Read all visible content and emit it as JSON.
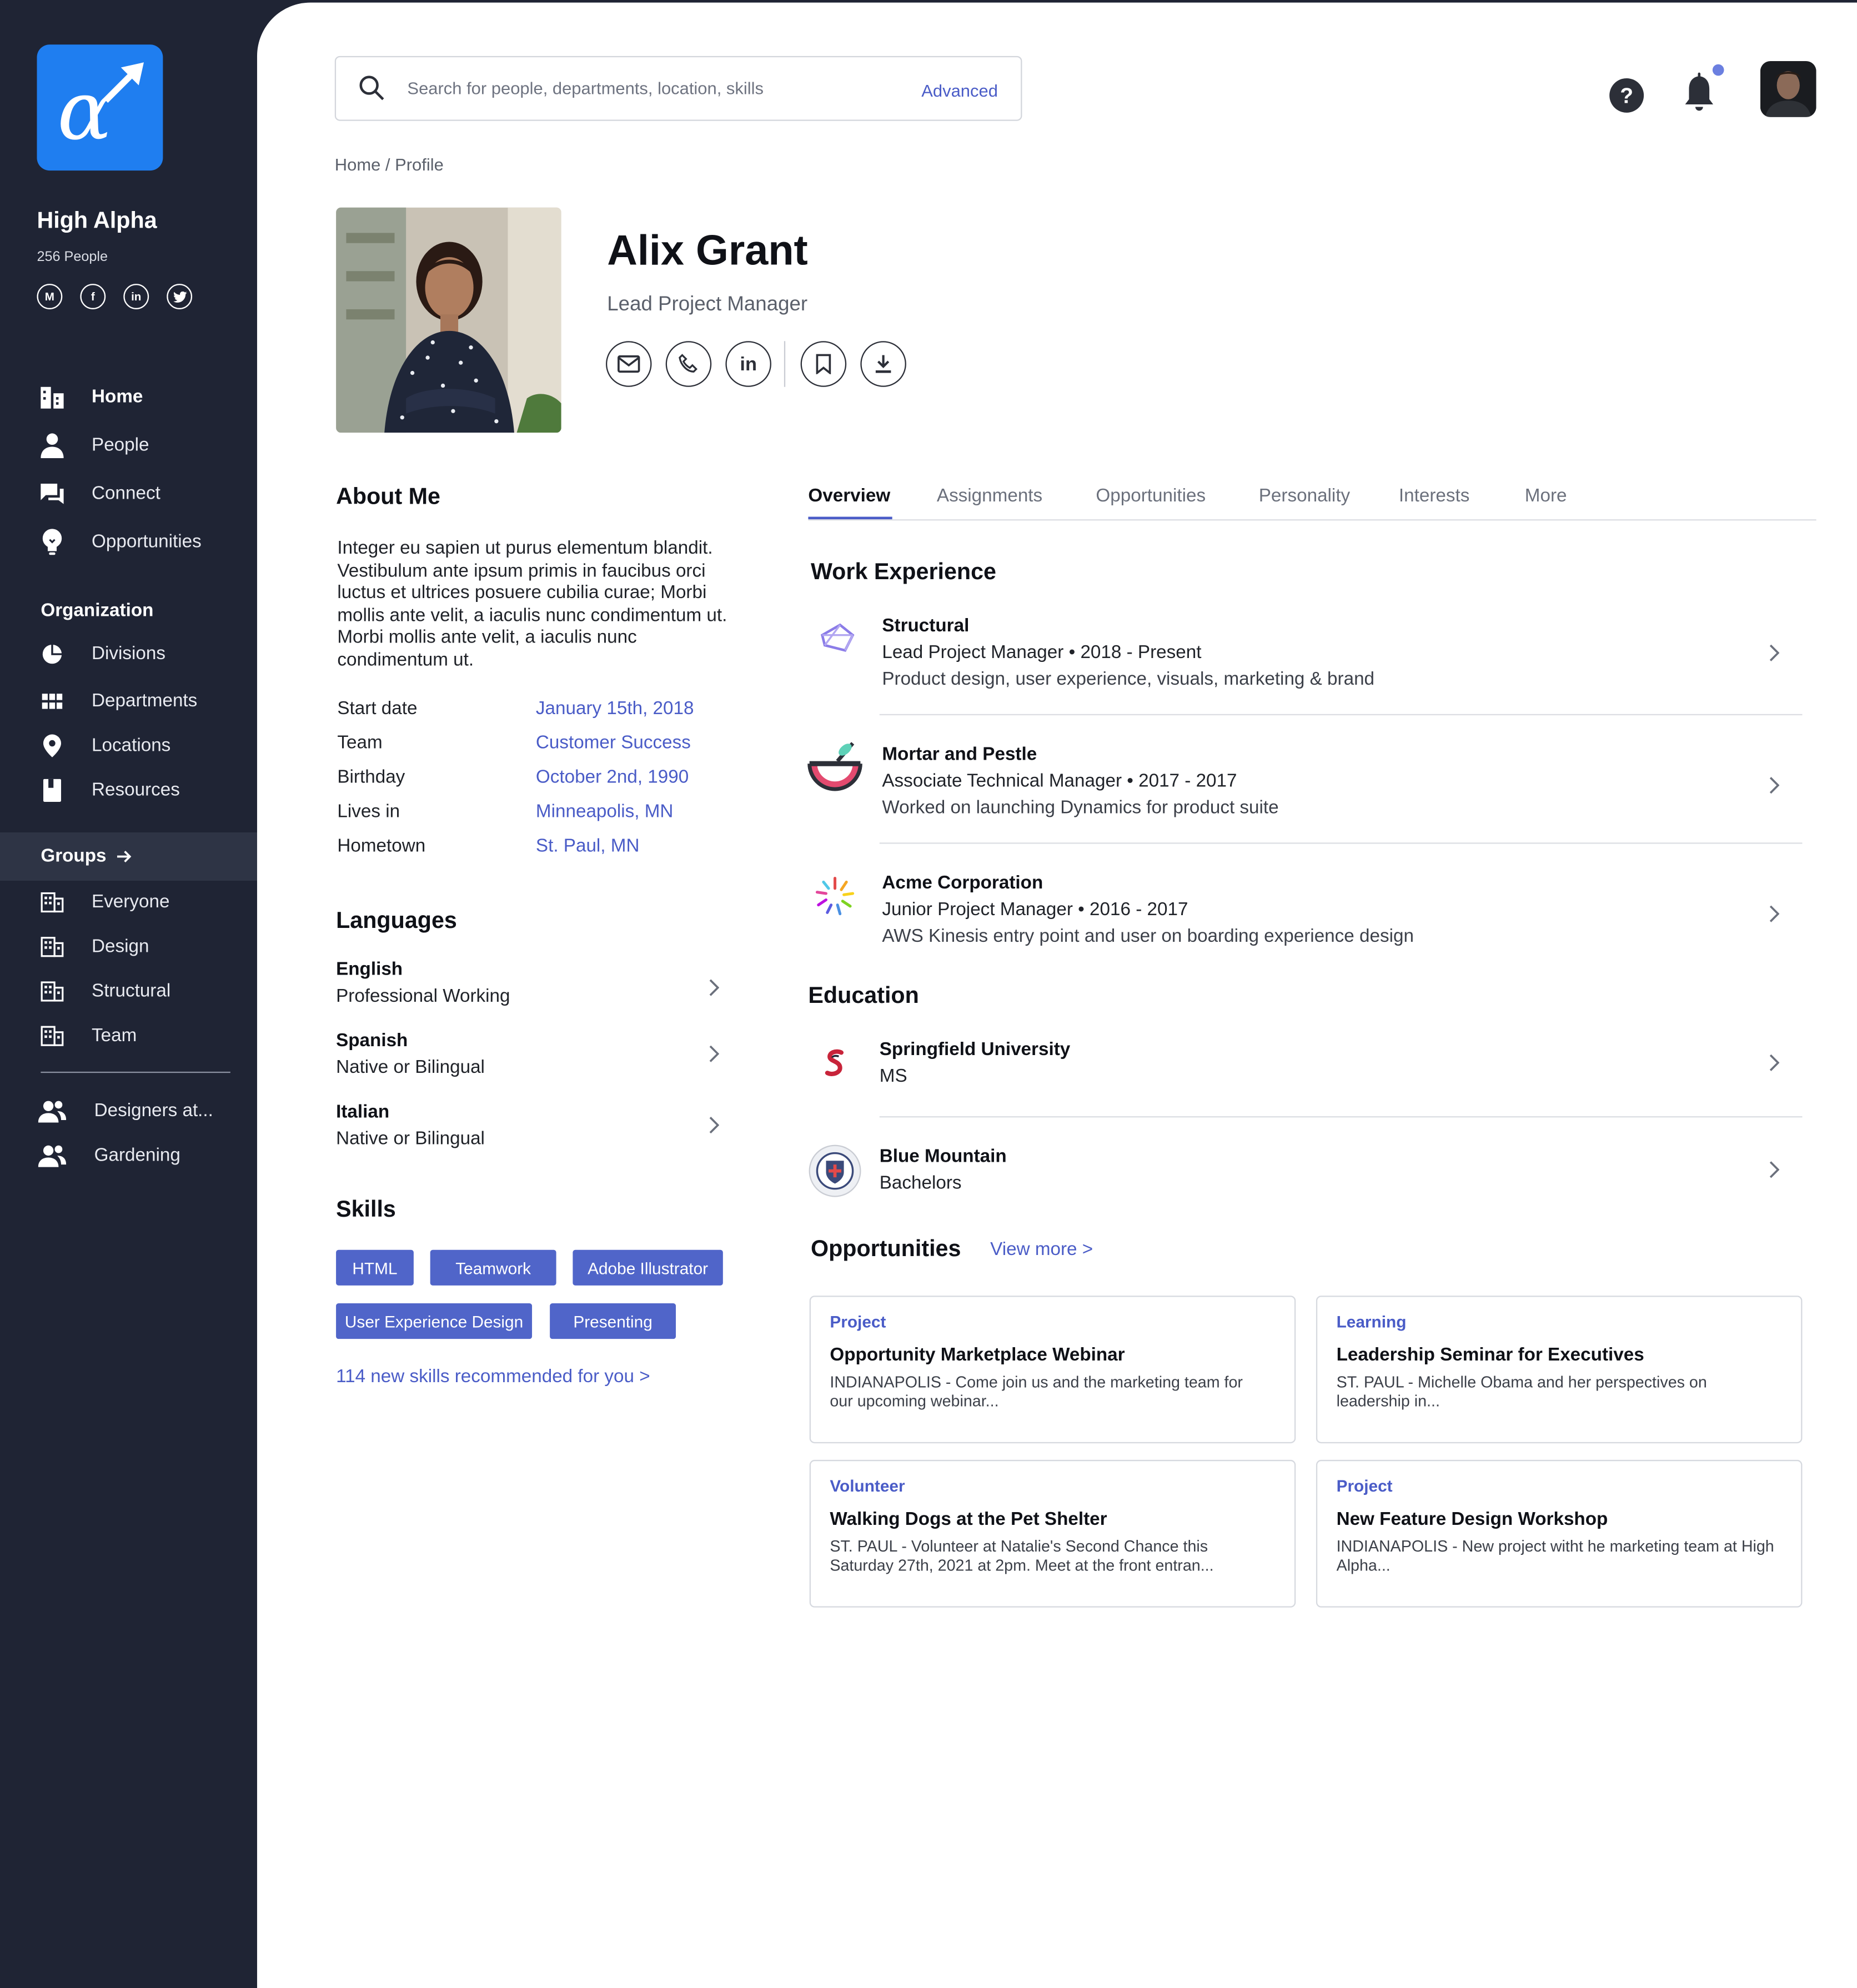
{
  "org": {
    "name": "High Alpha",
    "count": "256 People",
    "socials": [
      {
        "label": "M",
        "icon": "medium-icon"
      },
      {
        "label": "f",
        "icon": "facebook-icon"
      },
      {
        "label": "in",
        "icon": "linkedin-icon"
      },
      {
        "label": "t",
        "icon": "twitter-icon"
      }
    ]
  },
  "nav": {
    "main": [
      {
        "label": "Home",
        "icon": "building-icon"
      },
      {
        "label": "People",
        "icon": "person-icon"
      },
      {
        "label": "Connect",
        "icon": "chat-icon"
      },
      {
        "label": "Opportunities",
        "icon": "lightbulb-icon"
      }
    ],
    "organization_title": "Organization",
    "organization": [
      {
        "label": "Divisions",
        "icon": "pie-icon"
      },
      {
        "label": "Departments",
        "icon": "grid-icon"
      },
      {
        "label": "Locations",
        "icon": "pin-icon"
      },
      {
        "label": "Resources",
        "icon": "book-icon"
      }
    ],
    "groups_title": "Groups",
    "groups": [
      {
        "label": "Everyone",
        "icon": "office-icon"
      },
      {
        "label": "Design",
        "icon": "office-icon"
      },
      {
        "label": "Structural",
        "icon": "office-icon"
      },
      {
        "label": "Team",
        "icon": "office-icon"
      }
    ],
    "custom_groups": [
      {
        "label": "Designers at...",
        "icon": "people-icon"
      },
      {
        "label": "Gardening",
        "icon": "people-icon"
      }
    ]
  },
  "search": {
    "placeholder": "Search for people, departments, location, skills",
    "advanced": "Advanced"
  },
  "breadcrumb": "Home / Profile",
  "profile": {
    "name": "Alix Grant",
    "title": "Lead Project Manager",
    "actions": [
      "email-icon",
      "phone-icon",
      "linkedin-icon",
      "bookmark-icon",
      "download-icon"
    ]
  },
  "about": {
    "title": "About Me",
    "text": "Integer eu sapien ut purus elementum blandit. Vestibulum ante ipsum primis in faucibus orci luctus et ultrices posuere cubilia curae; Morbi mollis ante velit, a iaculis nunc condimentum ut. Morbi mollis ante velit, a iaculis nunc condimentum ut.",
    "facts": [
      {
        "label": "Start date",
        "value": "January 15th, 2018"
      },
      {
        "label": "Team",
        "value": "Customer Success"
      },
      {
        "label": "Birthday",
        "value": "October 2nd, 1990"
      },
      {
        "label": "Lives in",
        "value": "Minneapolis, MN"
      },
      {
        "label": "Hometown",
        "value": "St. Paul, MN"
      }
    ]
  },
  "languages": {
    "title": "Languages",
    "items": [
      {
        "name": "English",
        "level": "Professional Working"
      },
      {
        "name": "Spanish",
        "level": "Native or Bilingual"
      },
      {
        "name": "Italian",
        "level": "Native or Bilingual"
      }
    ]
  },
  "skills": {
    "title": "Skills",
    "items": [
      "HTML",
      "Teamwork",
      "Adobe Illustrator",
      "User Experience Design",
      "Presenting"
    ],
    "recommend": "114 new skills recommended for you >"
  },
  "tabs": [
    "Overview",
    "Assignments",
    "Opportunities",
    "Personality",
    "Interests",
    "More"
  ],
  "work": {
    "title": "Work Experience",
    "items": [
      {
        "company": "Structural",
        "role": "Lead Project Manager • 2018 - Present",
        "desc": "Product design, user experience, visuals, marketing & brand"
      },
      {
        "company": "Mortar and Pestle",
        "role": "Associate Technical Manager • 2017 - 2017",
        "desc": "Worked on launching Dynamics for product suite"
      },
      {
        "company": "Acme Corporation",
        "role": "Junior Project Manager • 2016 - 2017",
        "desc": "AWS Kinesis entry point and user on boarding experience design"
      }
    ]
  },
  "education": {
    "title": "Education",
    "items": [
      {
        "school": "Springfield University",
        "degree": "MS"
      },
      {
        "school": "Blue Mountain",
        "degree": "Bachelors"
      }
    ]
  },
  "opportunities": {
    "title": "Opportunities",
    "view_more": "View more >",
    "cards": [
      {
        "category": "Project",
        "title": "Opportunity Marketplace Webinar",
        "desc": "INDIANAPOLIS - Come join us and the marketing team for our upcoming webinar..."
      },
      {
        "category": "Learning",
        "title": "Leadership Seminar for Executives",
        "desc": "ST. PAUL  - Michelle Obama and her perspectives on leadership in..."
      },
      {
        "category": "Volunteer",
        "title": "Walking Dogs at the Pet Shelter",
        "desc": "ST. PAUL - Volunteer at Natalie's  Second Chance this Saturday 27th, 2021 at 2pm. Meet at the front entran..."
      },
      {
        "category": "Project",
        "title": "New Feature Design Workshop",
        "desc": "INDIANAPOLIS - New project witht he marketing team at High Alpha..."
      }
    ]
  },
  "colors": {
    "sidebar_bg": "#1f2434",
    "accent": "#4a5cc7",
    "skill_chip": "#5065c9",
    "logo_bg": "#1f7ef0"
  }
}
